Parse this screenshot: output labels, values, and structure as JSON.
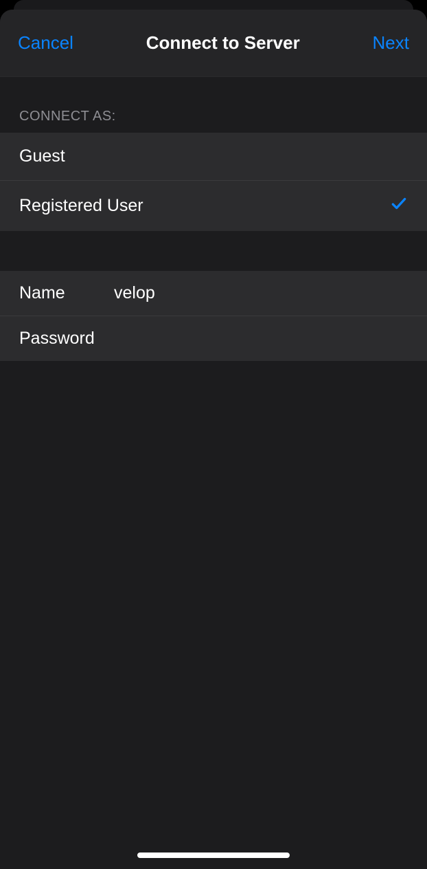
{
  "nav": {
    "cancel": "Cancel",
    "title": "Connect to Server",
    "next": "Next"
  },
  "sections": {
    "connect_as": {
      "header": "CONNECT AS:",
      "options": [
        {
          "label": "Guest",
          "selected": false
        },
        {
          "label": "Registered User",
          "selected": true
        }
      ]
    },
    "credentials": {
      "name_label": "Name",
      "name_value": "velop",
      "password_label": "Password",
      "password_value": ""
    }
  },
  "colors": {
    "accent": "#0a84ff",
    "background": "#1c1c1e",
    "row_background": "#2c2c2e",
    "separator": "#3a3a3c",
    "secondary_text": "#8e8e93"
  }
}
